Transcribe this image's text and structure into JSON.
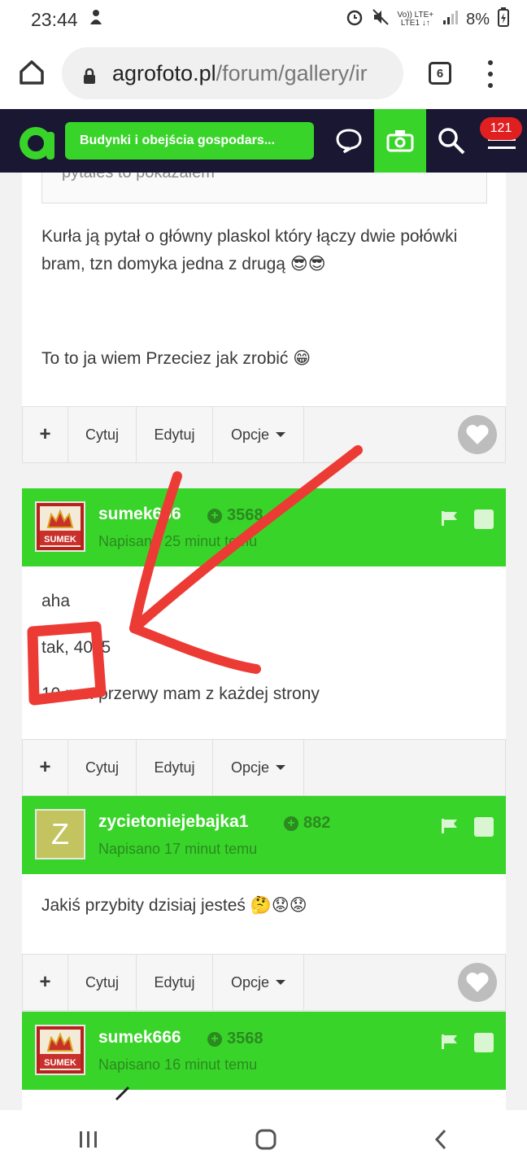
{
  "status_bar": {
    "time": "23:44",
    "network_top": "Vo)) LTE+",
    "network_bottom": "LTE1 ↓↑",
    "battery": "8%"
  },
  "browser": {
    "url_domain": "agrofoto.pl",
    "url_path": "/forum/gallery/ir",
    "tab_count": "6"
  },
  "site_header": {
    "breadcrumb": "Budynki i obejścia gospodars...",
    "notification_count": "121"
  },
  "posts": [
    {
      "quote_text": "pytałeś to pokazałem",
      "paragraphs": [
        "Kurła ją pytał o główny plaskol który łączy dwie połówki bram, tzn domyka jedna z drugą 😎😎",
        "To to ja wiem Przeciez jak zrobić 😁"
      ]
    },
    {
      "author": "sumek666",
      "reputation": "3568",
      "date": "Napisano 25 minut temu",
      "paragraphs": [
        "aha",
        "tak, 40x5",
        "10 mm przerwy mam z każdej strony"
      ]
    },
    {
      "author": "zycietoniejebajka1",
      "avatar_letter": "Z",
      "reputation": "882",
      "date": "Napisano 17 minut temu",
      "paragraphs": [
        "Jakiś przybity dzisiaj jesteś 🤔😟😟"
      ]
    },
    {
      "author": "sumek666",
      "reputation": "3568",
      "date": "Napisano 16 minut temu"
    }
  ],
  "toolbar": {
    "plus": "+",
    "quote": "Cytuj",
    "edit": "Edytuj",
    "options": "Opcje"
  },
  "avatar_text": "SUMEK",
  "colors": {
    "brand_green": "#39d42a",
    "header_dark": "#1a1733",
    "annotation_red": "#ec3b35"
  }
}
